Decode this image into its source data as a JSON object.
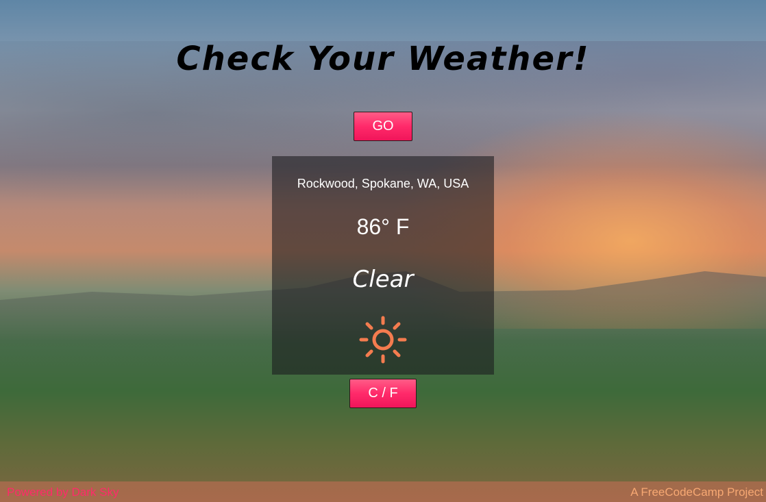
{
  "header": {
    "title": "Check Your Weather!"
  },
  "controls": {
    "go_label": "GO",
    "unit_toggle_label": "C / F"
  },
  "weather": {
    "location": "Rockwood, Spokane, WA, USA",
    "temperature": "86° F",
    "condition": "Clear",
    "icon": "sun-icon",
    "icon_color": "#f47c4f"
  },
  "footer": {
    "left_text": "Powered by Dark Sky",
    "right_text": "A FreeCodeCamp Project"
  },
  "colors": {
    "button_accent": "#ff2a6a",
    "footer_link": "#ff2a6a",
    "footer_right": "#f7a873"
  }
}
